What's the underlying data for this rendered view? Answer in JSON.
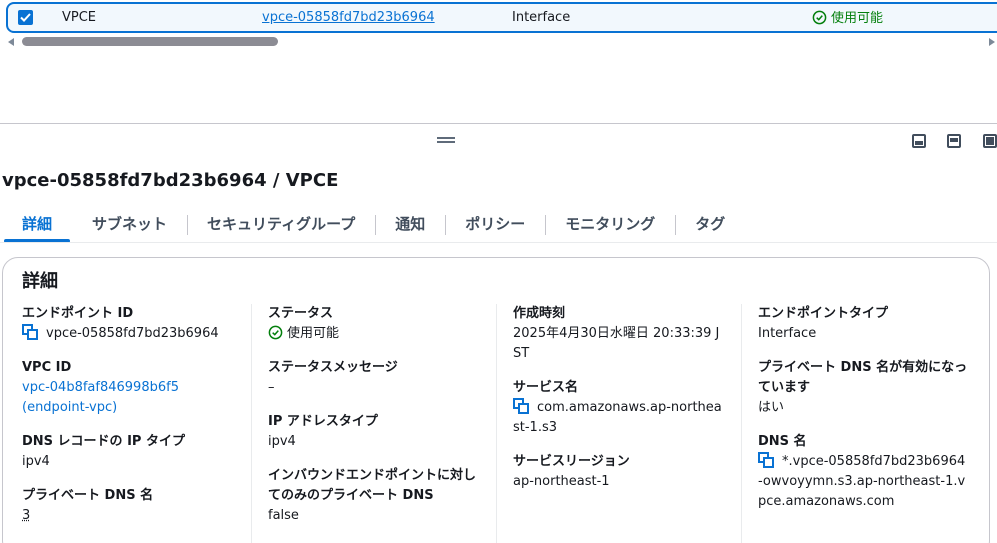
{
  "selected_row": {
    "name": "VPCE",
    "endpoint_id": "vpce-05858fd7bd23b6964",
    "type": "Interface",
    "status": "使用可能"
  },
  "detail": {
    "title": "vpce-05858fd7bd23b6964 / VPCE",
    "tabs": [
      "詳細",
      "サブネット",
      "セキュリティグループ",
      "通知",
      "ポリシー",
      "モニタリング",
      "タグ"
    ],
    "section_title": "詳細",
    "col1": {
      "endpoint_id_label": "エンドポイント ID",
      "endpoint_id": "vpce-05858fd7bd23b6964",
      "vpc_id_label": "VPC ID",
      "vpc_id": "vpc-04b8faf846998b6f5",
      "vpc_name": "(endpoint-vpc)",
      "dns_ip_type_label": "DNS レコードの IP タイプ",
      "dns_ip_type": "ipv4",
      "private_dns_label": "プライベート DNS 名",
      "private_dns": "3"
    },
    "col2": {
      "status_label": "ステータス",
      "status": "使用可能",
      "status_msg_label": "ステータスメッセージ",
      "status_msg": "–",
      "ip_type_label": "IP アドレスタイプ",
      "ip_type": "ipv4",
      "inbound_label": "インバウンドエンドポイントに対してのみのプライベート DNS",
      "inbound": "false"
    },
    "col3": {
      "created_label": "作成時刻",
      "created": "2025年4月30日水曜日 20:33:39 JST",
      "service_name_label": "サービス名",
      "service_name": "com.amazonaws.ap-northeast-1.s3",
      "service_region_label": "サービスリージョン",
      "service_region": "ap-northeast-1"
    },
    "col4": {
      "endpoint_type_label": "エンドポイントタイプ",
      "endpoint_type": "Interface",
      "private_dns_enabled_label": "プライベート DNS 名が有効になっています",
      "private_dns_enabled": "はい",
      "dns_names_label": "DNS 名",
      "dns_name": "*.vpce-05858fd7bd23b6964-owvoyymn.s3.ap-northeast-1.vpce.amazonaws.com"
    }
  },
  "colors": {
    "accent": "#0972d3",
    "success": "#037f0c",
    "text": "#16191f"
  }
}
